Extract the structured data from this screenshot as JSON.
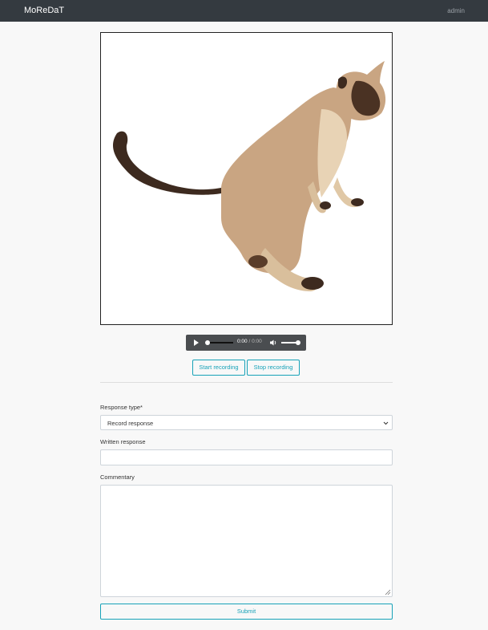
{
  "navbar": {
    "brand": "MoReDaT",
    "user": "admin"
  },
  "stimulus": {
    "description_icon": "siamese-cat-image"
  },
  "audio": {
    "current_time": "0:00",
    "separator": "/",
    "duration": "0:00",
    "progress": 0,
    "volume": 1
  },
  "recording": {
    "start_label": "Start recording",
    "stop_label": "Stop recording"
  },
  "form": {
    "response_type_label": "Response type*",
    "response_type_value": "Record response",
    "written_response_label": "Written response",
    "written_response_value": "",
    "commentary_label": "Commentary",
    "commentary_value": "",
    "submit_label": "Submit"
  },
  "colors": {
    "navbar": "#343a40",
    "accent": "#17a2b8",
    "background": "#f8f8f8"
  }
}
